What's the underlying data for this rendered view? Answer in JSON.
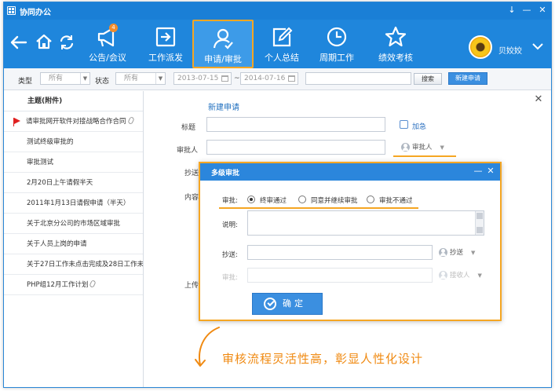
{
  "window": {
    "title": "协同办公",
    "controls": [
      "↓",
      "—",
      "✕"
    ]
  },
  "toolbar": {
    "items": [
      {
        "label": "公告/会议",
        "icon": "megaphone-icon",
        "badge": "4"
      },
      {
        "label": "工作派发",
        "icon": "dispatch-icon"
      },
      {
        "label": "申请/审批",
        "icon": "approval-user-icon",
        "active": true
      },
      {
        "label": "个人总结",
        "icon": "edit-note-icon"
      },
      {
        "label": "周期工作",
        "icon": "clock-icon"
      },
      {
        "label": "绩效考核",
        "icon": "star-icon"
      }
    ],
    "username": "贝姣姣"
  },
  "filter": {
    "type_label": "类型",
    "type_value": "所有",
    "status_label": "状态",
    "status_value": "所有",
    "date_from": "2013-07-15",
    "date_sep": "~",
    "date_to": "2014-07-16",
    "search_value": "",
    "search_button": "搜索",
    "new_button": "新建申请"
  },
  "sidebar": {
    "header": "主题(附件)",
    "items": [
      {
        "text": "请审批网开软件对接战略合作合同",
        "flag": true,
        "attachment": true
      },
      {
        "text": "测试终级审批的"
      },
      {
        "text": "审批测试"
      },
      {
        "text": "2月20日上午请假半天"
      },
      {
        "text": "2011年1月13日请假申请（半天）"
      },
      {
        "text": "关于北京分公司的市场区域审批"
      },
      {
        "text": "关于人员上岗的申请"
      },
      {
        "text": "关于27日工作未点击完成及28日工作未"
      },
      {
        "text": "PHP组12月工作计划",
        "attachment": true
      }
    ]
  },
  "form": {
    "title": "新建申请",
    "subject_label": "标题",
    "subject_value": "",
    "urgent_label": "加急",
    "approver_label": "审批人",
    "approver_value": "",
    "approver_pick": "审批人",
    "cc_label": "抄送",
    "content_label": "内容",
    "upload_label": "上传"
  },
  "dialog": {
    "title": "多级审批",
    "approve_label": "审批:",
    "options": [
      "终审通过",
      "同意并继续审批",
      "审批不通过"
    ],
    "selected_option": "终审通过",
    "note_label": "说明:",
    "note_value": "",
    "cc_label": "抄送:",
    "cc_value": "",
    "cc_pick": "抄送",
    "approver_label": "审批:",
    "approver_value": "",
    "approver_pick": "接收人",
    "ok_button": "确定"
  },
  "caption": "审核流程灵活性高，彰显人性化设计",
  "colors": {
    "brand_blue": "#1f86dc",
    "highlight_orange": "#f5a623",
    "flag_red": "#e02020"
  }
}
